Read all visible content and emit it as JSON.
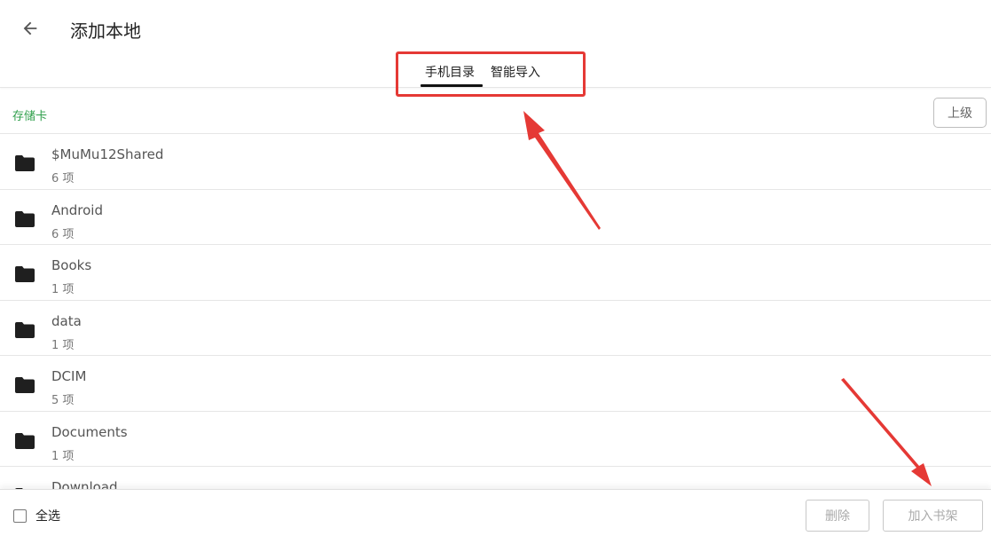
{
  "header": {
    "title": "添加本地",
    "back_icon": "arrow-left-icon"
  },
  "tabs": [
    {
      "label": "手机目录",
      "active": true
    },
    {
      "label": "智能导入",
      "active": false
    }
  ],
  "pathbar": {
    "path": "存储卡",
    "up_label": "上级"
  },
  "files": [
    {
      "name": "$MuMu12Shared",
      "count": "6 项"
    },
    {
      "name": "Android",
      "count": "6 项"
    },
    {
      "name": "Books",
      "count": "1 项"
    },
    {
      "name": "data",
      "count": "1 项"
    },
    {
      "name": "DCIM",
      "count": "5 项"
    },
    {
      "name": "Documents",
      "count": "1 项"
    },
    {
      "name": "Download",
      "count": ""
    }
  ],
  "footer": {
    "select_all_label": "全选",
    "delete_label": "删除",
    "add_label": "加入书架"
  },
  "colors": {
    "accent_green": "#2e9e4a",
    "annotation_red": "#e53935"
  }
}
